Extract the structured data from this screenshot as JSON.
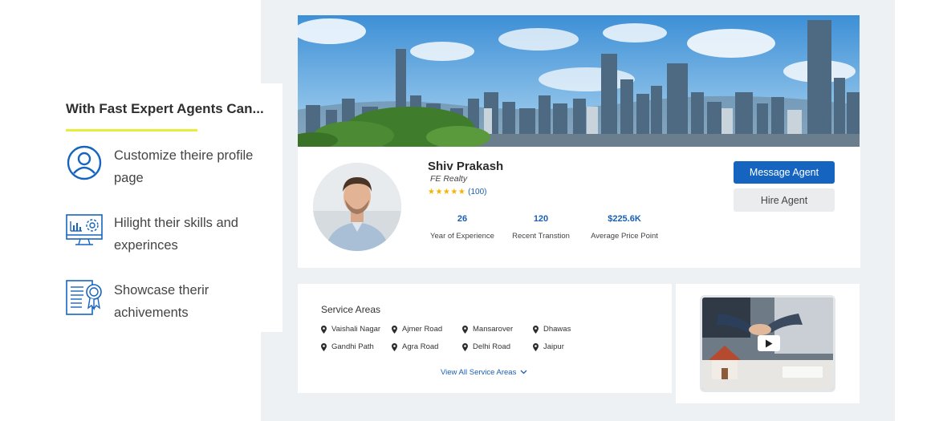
{
  "features": {
    "title": "With Fast Expert Agents Can...",
    "items": [
      {
        "icon": "user-circle-icon",
        "text": "Customize theire profile page"
      },
      {
        "icon": "dashboard-gear-icon",
        "text": "Hilight their skills and experinces"
      },
      {
        "icon": "certificate-icon",
        "text": "Showcase therir achivements"
      }
    ],
    "accent_color": "#e8ec3a",
    "icon_color": "#1565c0"
  },
  "profile": {
    "name": "Shiv Prakash",
    "company": "FE Realty",
    "stars": "★★★★★",
    "rating_count": "(100)",
    "stats": [
      {
        "value": "26",
        "label": "Year of Experience"
      },
      {
        "value": "120",
        "label": "Recent Transtion"
      },
      {
        "value": "$225.6K",
        "label": "Average Price Point"
      }
    ],
    "message_button": "Message Agent",
    "hire_button": "Hire Agent"
  },
  "service_areas": {
    "title": "Service Areas",
    "areas": [
      "Vaishali Nagar",
      "Ajmer Road",
      "Mansarover",
      "Dhawas",
      "Gandhi Path",
      "Agra Road",
      "Delhi Road",
      "Jaipur"
    ],
    "view_all": "View All Service Areas"
  },
  "video": {
    "play_icon": "play-icon"
  },
  "colors": {
    "primary": "#1565c0",
    "panel_bg": "#eef1f4",
    "star": "#f5b400"
  }
}
